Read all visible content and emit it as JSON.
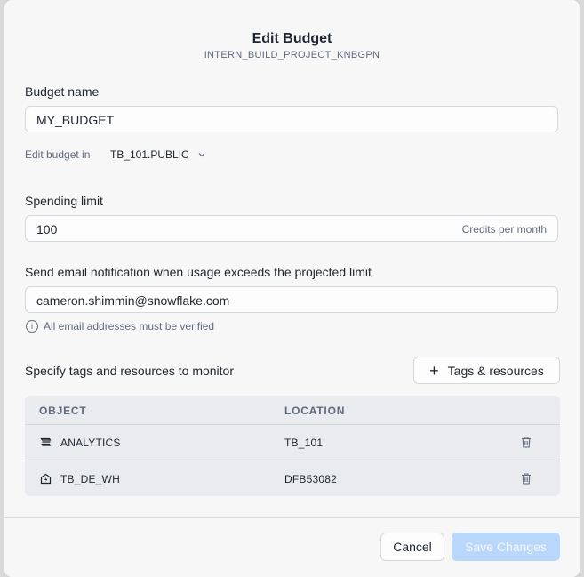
{
  "modal": {
    "title": "Edit Budget",
    "subtitle": "INTERN_BUILD_PROJECT_KNBGPN"
  },
  "budget_name": {
    "label": "Budget name",
    "value": "MY_BUDGET",
    "edit_in_label": "Edit budget in",
    "edit_in_value": "TB_101.PUBLIC"
  },
  "spending_limit": {
    "label": "Spending limit",
    "value": "100",
    "suffix": "Credits per month"
  },
  "email": {
    "label": "Send email notification when usage exceeds the projected limit",
    "value": "cameron.shimmin@snowflake.com",
    "hint": "All email addresses must be verified"
  },
  "resources": {
    "label": "Specify tags and resources to monitor",
    "add_button": "Tags & resources",
    "columns": [
      "OBJECT",
      "LOCATION"
    ],
    "rows": [
      {
        "object": "ANALYTICS",
        "location": "TB_101",
        "icon": "database-icon"
      },
      {
        "object": "TB_DE_WH",
        "location": "DFB53082",
        "icon": "warehouse-icon"
      }
    ]
  },
  "footer": {
    "cancel": "Cancel",
    "save": "Save Changes"
  },
  "colors": {
    "accent_disabled": "#b9d6fb",
    "text_primary": "#1e252f",
    "text_secondary": "#5d6a7e"
  }
}
